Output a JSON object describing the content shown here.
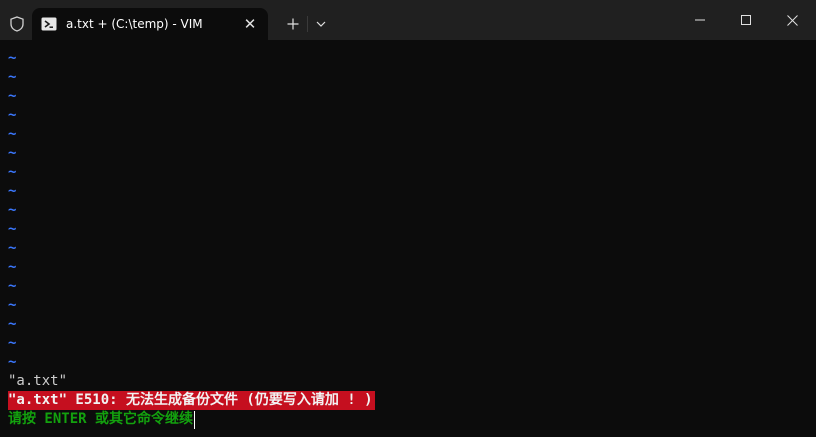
{
  "window": {
    "tab_title": "a.txt + (C:\\temp) - VIM",
    "tab_close_glyph": "✕",
    "new_tab_glyph": "+"
  },
  "colors": {
    "tilde": "#3b78ff",
    "error_bg": "#c50f1f",
    "prompt": "#13a10e"
  },
  "terminal": {
    "tilde_char": "~",
    "tilde_count": 17,
    "file_line": "\"a.txt\"",
    "error_line": "\"a.txt\" E510: 无法生成备份文件 (仍要写入请加 ! )",
    "prompt_line": "请按 ENTER 或其它命令继续"
  }
}
